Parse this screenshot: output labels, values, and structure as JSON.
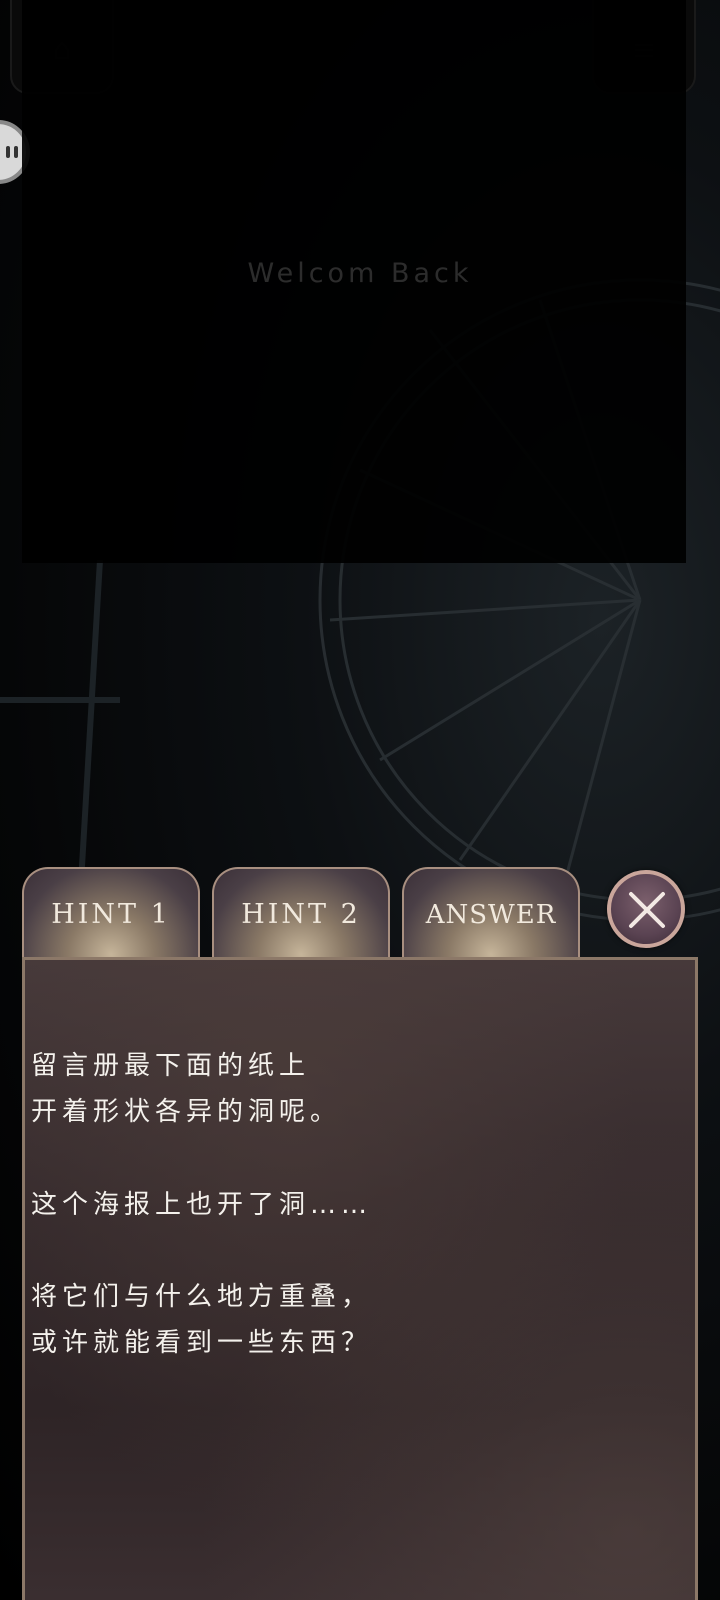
{
  "welcome_text": "Welcom Back",
  "tabs": {
    "hint1": "HINT 1",
    "hint2": "HINT 2",
    "answer": "ANSWER"
  },
  "close_icon": "close-x-icon",
  "hint_text": {
    "line1": "留言册最下面的纸上",
    "line2": "开着形状各异的洞呢。",
    "line3": "这个海报上也开了洞……",
    "line4": "将它们与什么地方重叠，",
    "line5": "或许就能看到一些东西？"
  },
  "colors": {
    "tab_border": "#a88f80",
    "close_ring": "#caa69b",
    "panel_text": "#f4f1ec"
  }
}
